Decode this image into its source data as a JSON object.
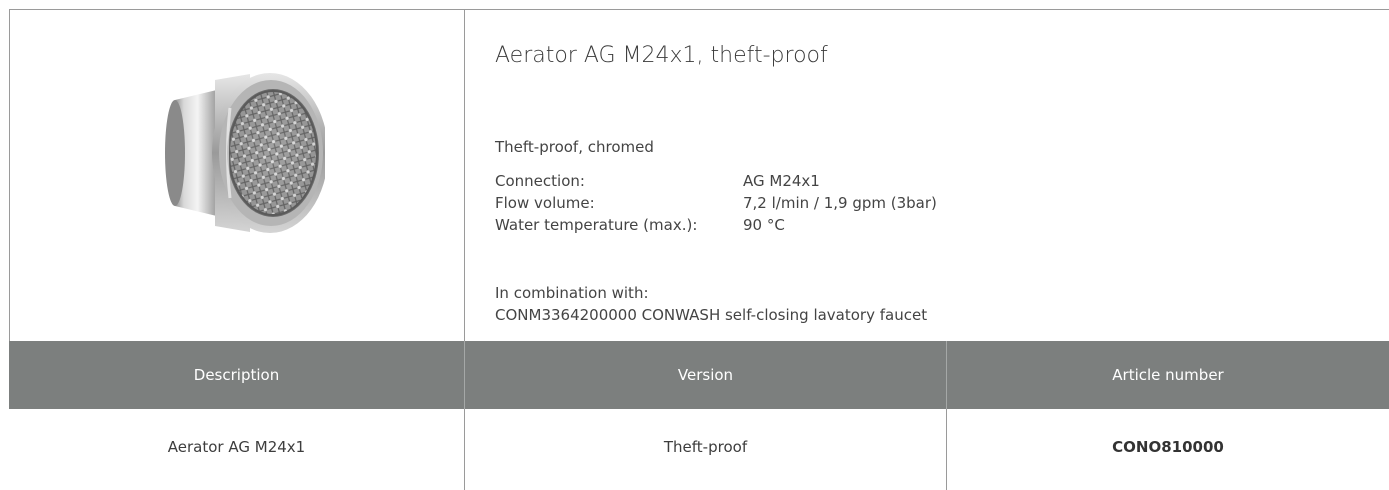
{
  "product": {
    "title": "Aerator AG M24x1, theft-proof",
    "subtitle": "Theft-proof, chromed",
    "specs": [
      {
        "label": "Connection:",
        "value": "AG M24x1"
      },
      {
        "label": "Flow volume:",
        "value": "7,2 l/min / 1,9 gpm (3bar)"
      },
      {
        "label": "Water temperature (max.):",
        "value": "90 °C"
      }
    ],
    "combination_label": "In combination with:",
    "combination_value": "CONM3364200000 CONWASH self-closing lavatory faucet",
    "image_icon": "aerator-product-icon"
  },
  "table": {
    "headers": [
      "Description",
      "Version",
      "Article number"
    ],
    "rows": [
      [
        "Aerator AG M24x1",
        "Theft-proof",
        "CONO810000"
      ]
    ]
  },
  "colors": {
    "header_band": "#7c7f7e",
    "text": "#3d3d3d",
    "border": "#9a9a9a"
  }
}
